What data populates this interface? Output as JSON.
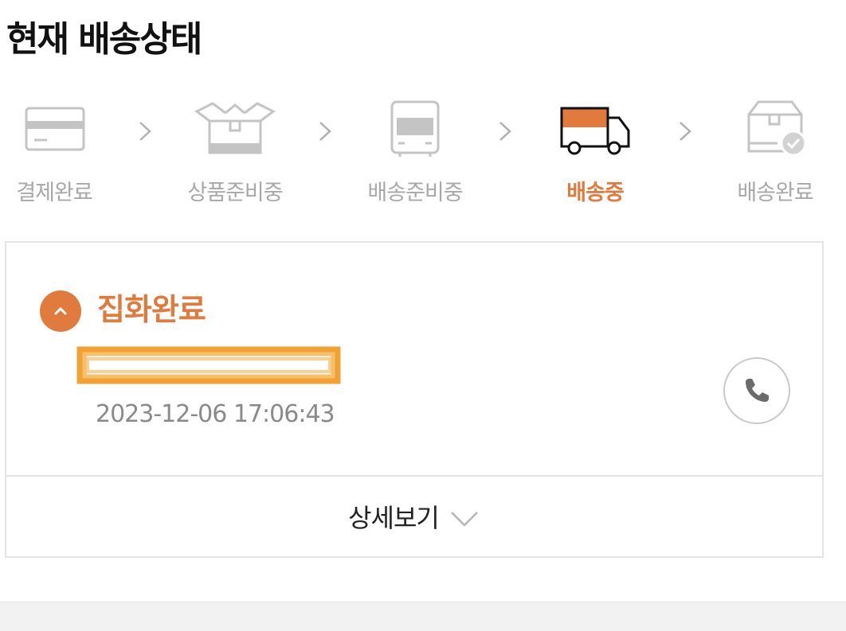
{
  "header": {
    "title": "현재 배송상태"
  },
  "steps": [
    {
      "label": "결제완료",
      "icon": "credit-card-icon",
      "active": false
    },
    {
      "label": "상품준비중",
      "icon": "open-box-icon",
      "active": false
    },
    {
      "label": "배송준비중",
      "icon": "bus-icon",
      "active": false
    },
    {
      "label": "배송중",
      "icon": "delivery-truck-icon",
      "active": true
    },
    {
      "label": "배송완료",
      "icon": "box-check-icon",
      "active": false
    }
  ],
  "tracking": {
    "event_title": "집화완료",
    "timestamp": "2023-12-06 17:06:43",
    "detail_label": "상세보기"
  },
  "colors": {
    "accent": "#e07b3d",
    "inactive": "#a8a8a8",
    "redaction": "#f2a233"
  }
}
